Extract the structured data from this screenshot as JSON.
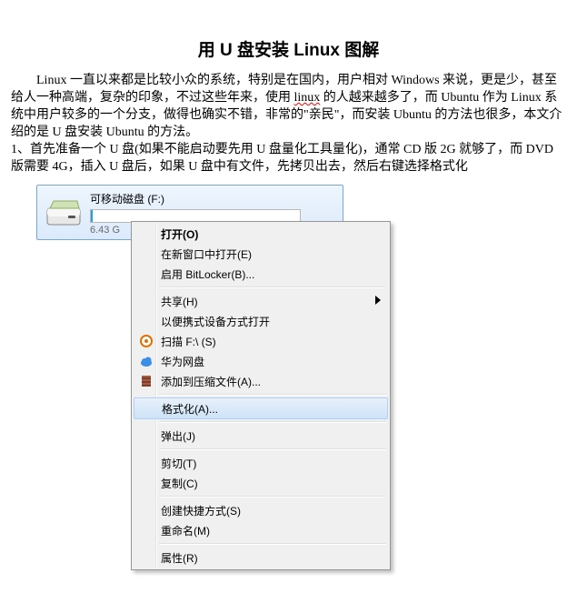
{
  "title": "用 U 盘安装 Linux 图解",
  "para1a": "Linux 一直以来都是比较小众的系统，特别是在国内，用户相对 Windows 来说，更是少，甚至给人一种高端，复杂的印象，不过这些年来，使用 ",
  "para1_link": "linux",
  "para1b": " 的人越来越多了，而 Ubuntu 作为 Linux 系统中用户较多的一个分支，做得也确实不错，非常的\"亲民\"，而安装 Ubuntu 的方法也很多，本文介绍的是 U 盘安装 Ubuntu 的方法。",
  "para2": "1、首先准备一个 U 盘(如果不能启动要先用 U 盘量化工具量化)，通常 CD 版 2G 就够了，而 DVD 版需要 4G，插入 U 盘后，如果 U 盘中有文件，先拷贝出去，然后右键选择格式化",
  "drive": {
    "name": "可移动磁盘 (F:)",
    "free": "6.43 G"
  },
  "menu": [
    {
      "type": "item",
      "label": "打开(O)",
      "bold": true
    },
    {
      "type": "item",
      "label": "在新窗口中打开(E)"
    },
    {
      "type": "item",
      "label": "启用 BitLocker(B)..."
    },
    {
      "type": "sep"
    },
    {
      "type": "item",
      "label": "共享(H)",
      "arrow": true
    },
    {
      "type": "item",
      "label": "以便携式设备方式打开"
    },
    {
      "type": "item",
      "label": "扫描 F:\\ (S)",
      "icon": "virus-scan"
    },
    {
      "type": "item",
      "label": "华为网盘",
      "icon": "cloud"
    },
    {
      "type": "item",
      "label": "添加到压缩文件(A)...",
      "icon": "archive"
    },
    {
      "type": "sep"
    },
    {
      "type": "item",
      "label": "格式化(A)...",
      "hover": true
    },
    {
      "type": "sep"
    },
    {
      "type": "item",
      "label": "弹出(J)"
    },
    {
      "type": "sep"
    },
    {
      "type": "item",
      "label": "剪切(T)"
    },
    {
      "type": "item",
      "label": "复制(C)"
    },
    {
      "type": "sep"
    },
    {
      "type": "item",
      "label": "创建快捷方式(S)"
    },
    {
      "type": "item",
      "label": "重命名(M)"
    },
    {
      "type": "sep"
    },
    {
      "type": "item",
      "label": "属性(R)"
    }
  ]
}
